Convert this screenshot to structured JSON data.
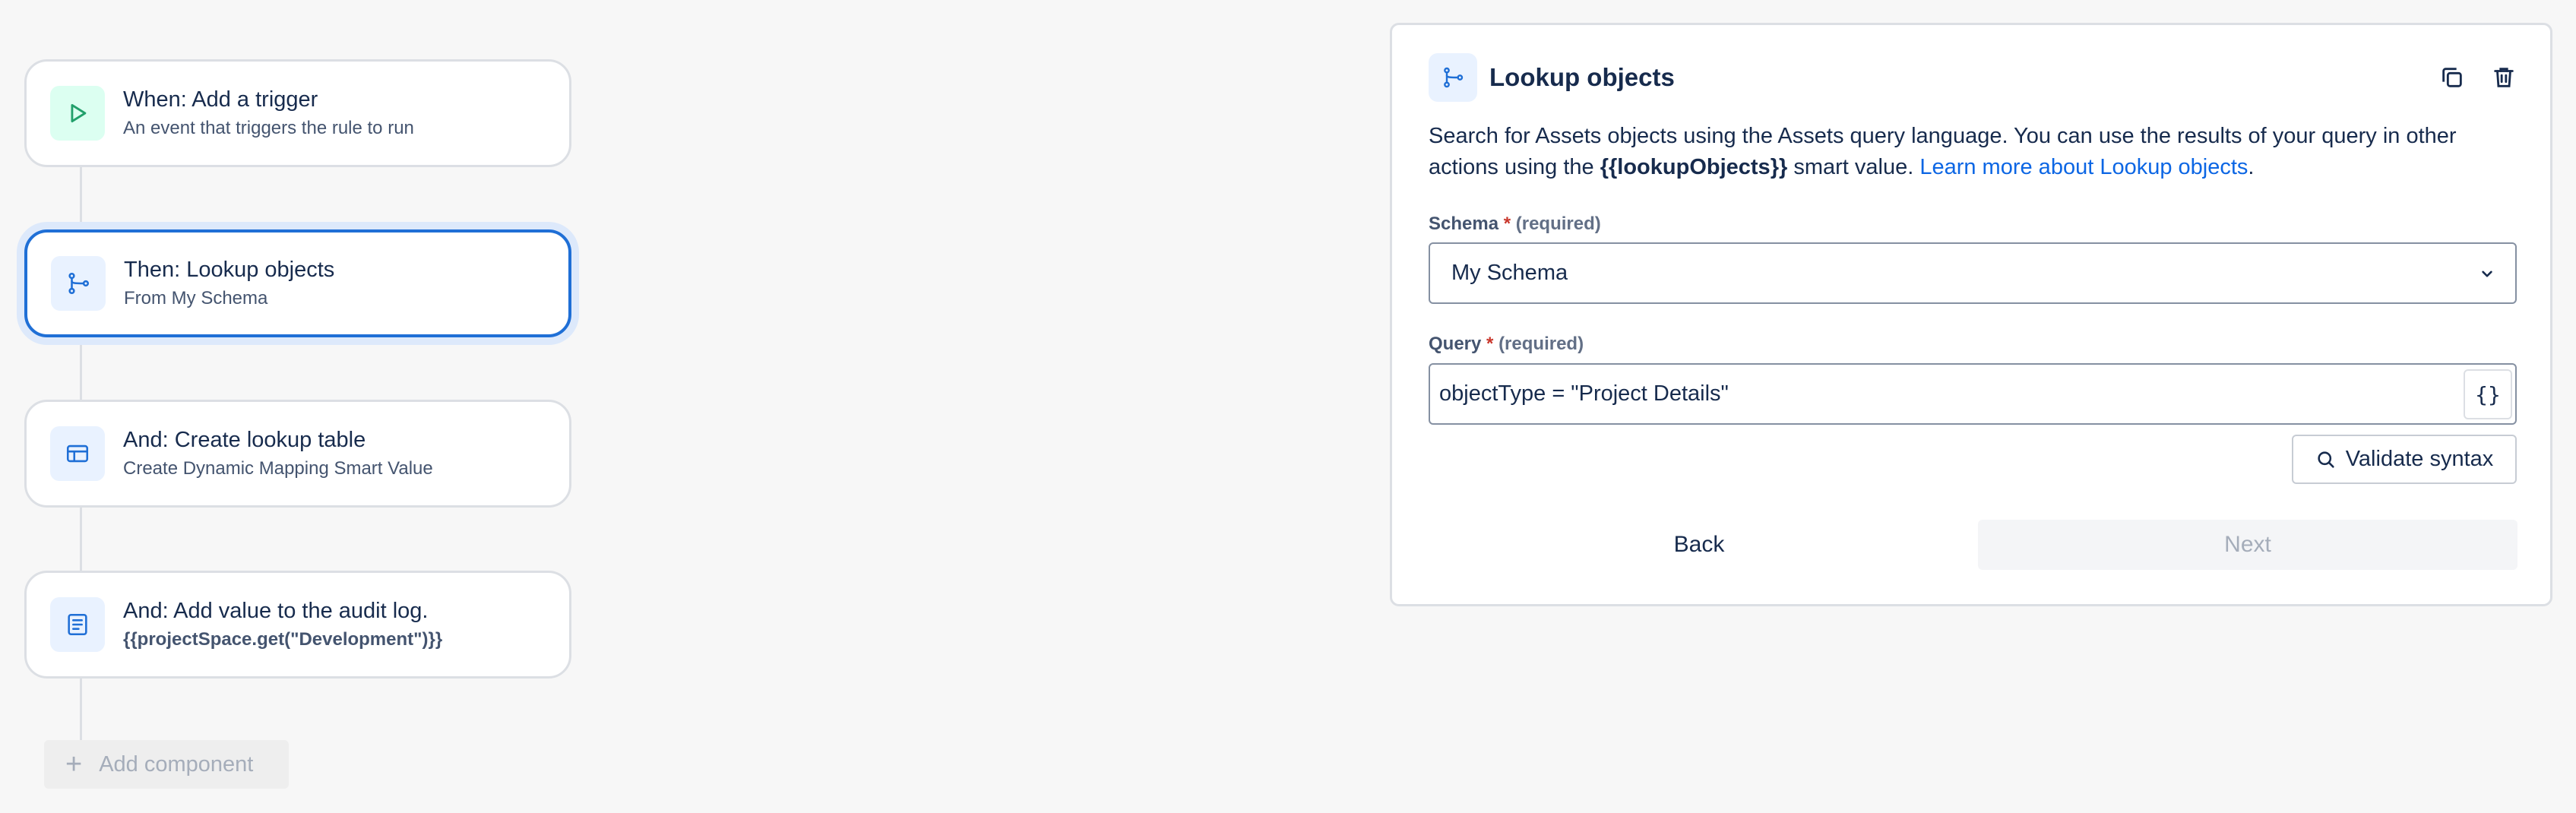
{
  "rule_flow": {
    "cards": [
      {
        "title": "When: Add a trigger",
        "subtitle": "An event that triggers the rule to run",
        "icon": "play-icon"
      },
      {
        "title": "Then: Lookup objects",
        "subtitle": "From My Schema",
        "icon": "branch-icon",
        "selected": true
      },
      {
        "title": "And: Create lookup table",
        "subtitle": "Create Dynamic Mapping Smart Value",
        "icon": "table-icon"
      },
      {
        "title": "And: Add value to the audit log.",
        "subtitle": "{{projectSpace.get(\"Development\")}}",
        "icon": "document-icon"
      }
    ],
    "add_component_label": "Add component"
  },
  "panel": {
    "title": "Lookup objects",
    "description": {
      "part1": "Search for Assets objects using the Assets query language. You can use the results of your query in other actions using the ",
      "smart_value": "{{lookupObjects}}",
      "part2": " smart value. ",
      "link": "Learn more about Lookup objects",
      "end": "."
    },
    "schema": {
      "label": "Schema",
      "required_star": "*",
      "required_text": "(required)",
      "value": "My Schema"
    },
    "query": {
      "label": "Query",
      "required_star": "*",
      "required_text": "(required)",
      "value": "objectType = \"Project Details\"",
      "smart_value_button": "{}"
    },
    "validate_label": "Validate syntax",
    "back_label": "Back",
    "next_label": "Next"
  },
  "colors": {
    "accent": "#1f6fd6",
    "link": "#0c66e4",
    "required": "#c9372c",
    "trigger_icon_bg": "#dcfff1",
    "action_icon_bg": "#e9f2ff"
  }
}
